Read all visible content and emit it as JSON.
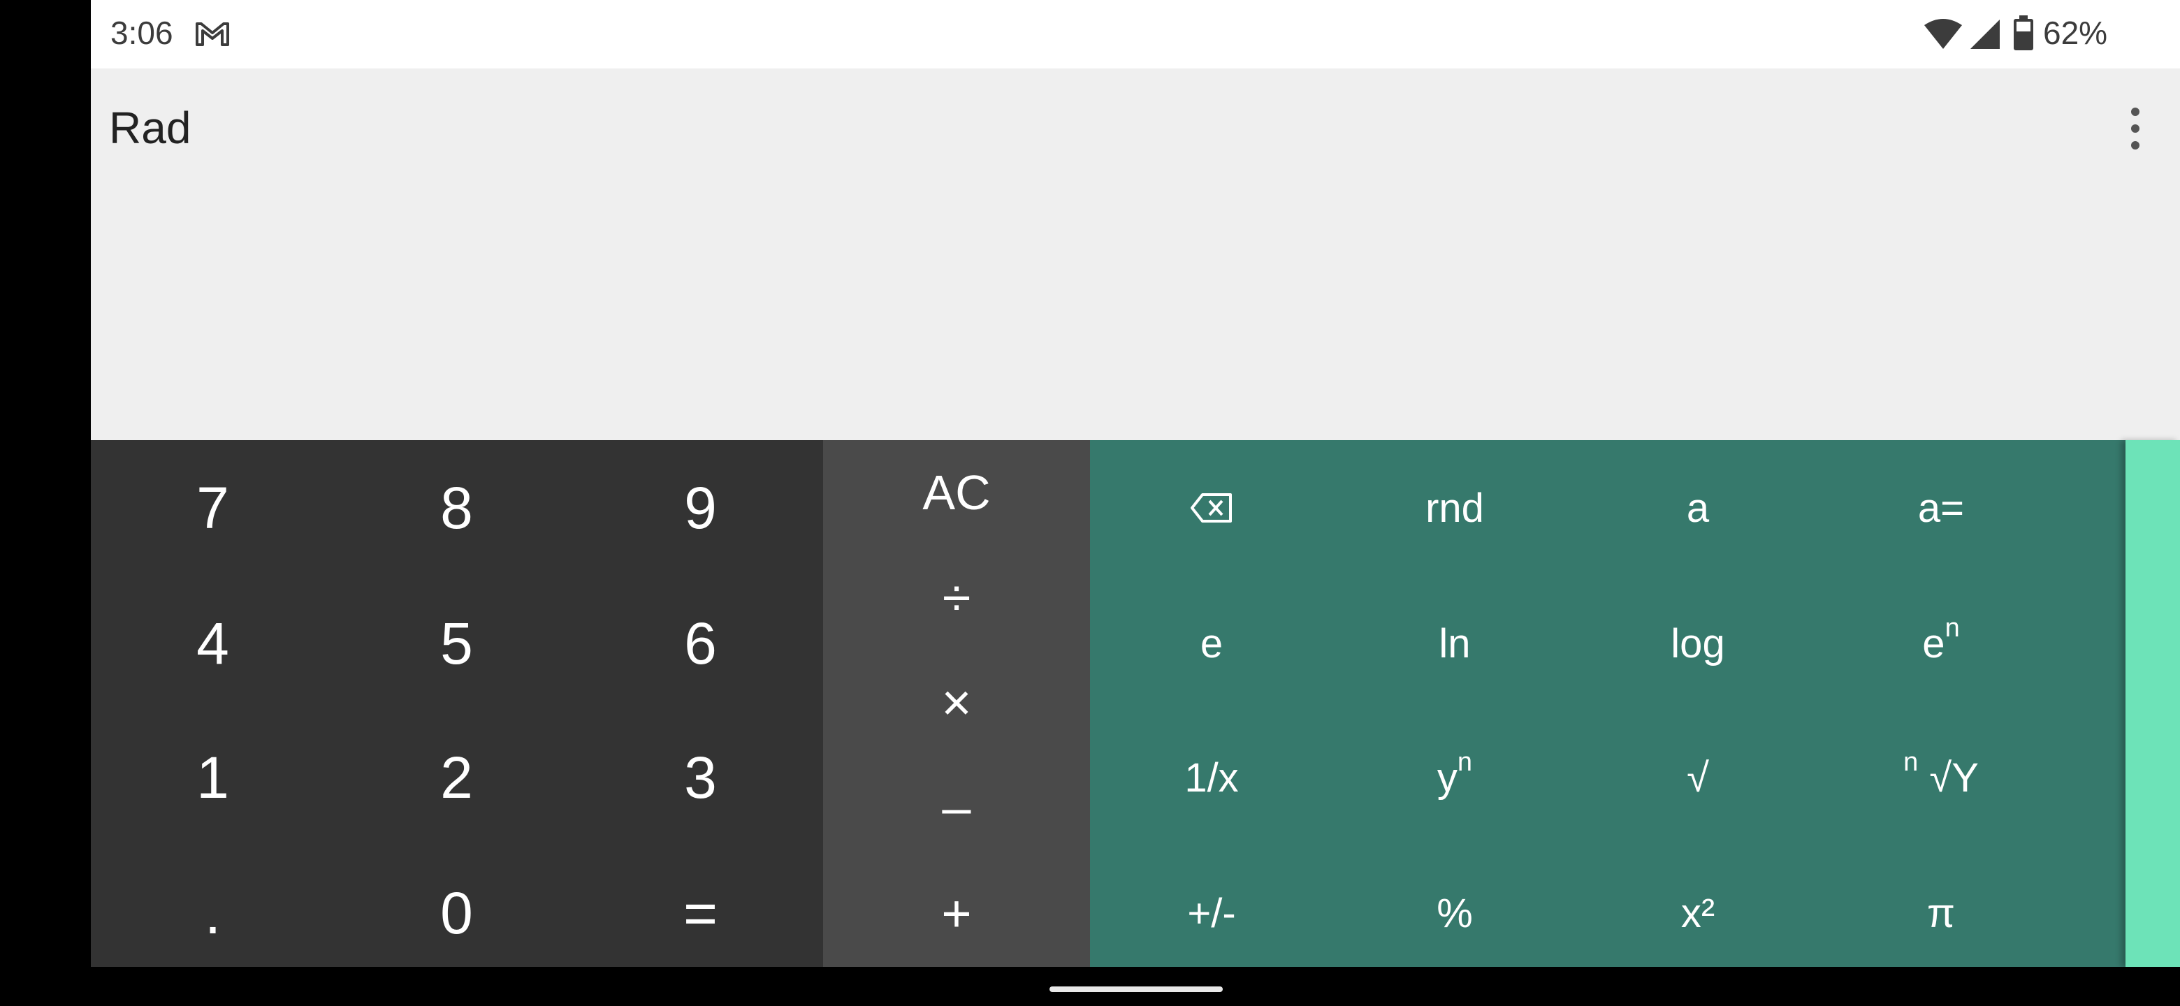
{
  "status_bar": {
    "time": "3:06",
    "battery": "62%",
    "icons": [
      "gmail-icon",
      "wifi-icon",
      "cell-signal-icon",
      "battery-icon"
    ]
  },
  "display": {
    "angle_mode": "Rad",
    "menu_icon": "overflow-menu-icon",
    "background": "#efefef"
  },
  "numpad": {
    "row1": [
      "7",
      "8",
      "9"
    ],
    "row2": [
      "4",
      "5",
      "6"
    ],
    "row3": [
      "1",
      "2",
      "3"
    ],
    "row4": [
      ".",
      "0",
      "="
    ]
  },
  "operators": {
    "clear": "AC",
    "divide": "÷",
    "multiply": "×",
    "subtract": "–",
    "add": "+"
  },
  "advanced": {
    "backspace_icon": "backspace-icon",
    "rnd": "rnd",
    "a": "a",
    "a_assign": "a=",
    "e": "e",
    "ln": "ln",
    "log": "log",
    "e_pow_base": "e",
    "e_pow_sup": "n",
    "reciprocal": "1/x",
    "y_pow_base": "y",
    "y_pow_sup": "n",
    "sqrt": "√",
    "nth_root_sup": "n",
    "nth_root_base": " √Y",
    "negate": "+/-",
    "percent": "%",
    "square": "x²",
    "pi": "π"
  },
  "colors": {
    "numpad": "#333333",
    "operators": "#4a4a4a",
    "advanced": "#36796c",
    "accent_edge": "#6de3b8"
  }
}
